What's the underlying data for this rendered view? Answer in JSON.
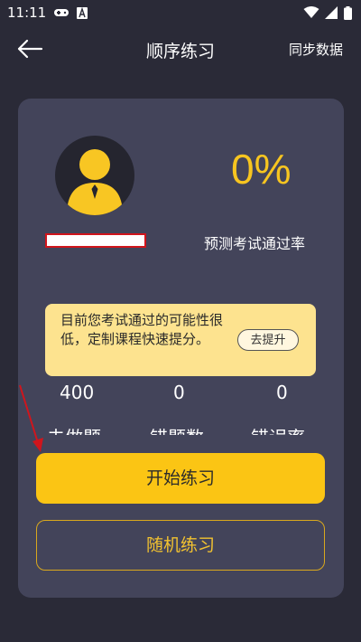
{
  "status": {
    "time": "11:11"
  },
  "header": {
    "title": "顺序练习",
    "sync_label": "同步数据"
  },
  "profile": {
    "pass_rate": "0%",
    "pass_rate_label": "预测考试通过率"
  },
  "tip": {
    "text": "目前您考试通过的可能性很低，定制课程快速提分。",
    "button_label": "去提升"
  },
  "stats": [
    {
      "value": "400",
      "label": "未做题"
    },
    {
      "value": "0",
      "label": "错题数"
    },
    {
      "value": "0",
      "label": "错误率"
    }
  ],
  "actions": {
    "start_label": "开始练习",
    "random_label": "随机练习"
  },
  "colors": {
    "background": "#2a2a37",
    "card": "#43445a",
    "accent": "#fbc514",
    "tip_background": "#fde38f"
  }
}
